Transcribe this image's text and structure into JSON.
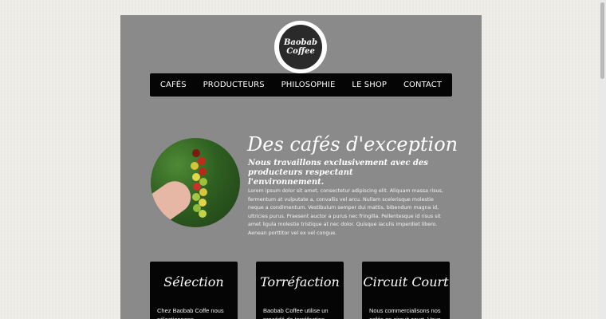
{
  "logo": {
    "text_line1": "Baobab",
    "text_line2": "Coffee"
  },
  "nav": {
    "items": [
      "CAFÉS",
      "PRODUCTEURS",
      "PHILOSOPHIE",
      "LE SHOP",
      "CONTACT"
    ]
  },
  "hero": {
    "title": "Des cafés d'exception",
    "subtitle": "Nous travaillons exclusivement avec des producteurs respectant l'environnement.",
    "body": "Lorem ipsum dolor sit amet, consectetur adipiscing elit. Aliquam massa risus, fermentum at vulputate a, convallis vel arcu. Nullam scelerisque molestie neque a condimentum. Vestibulum semper dui mattis, bibendum magna id, ultricies purus. Praesent auctor a purus nec fringilla. Pellentesque id risus sit amet ligula molestie tristique at nec dolor. Quisque iaculis imperdiet libero. Aenean porttitor vel ex vel congue."
  },
  "cards": [
    {
      "title": "Sélection",
      "text": "Chez Baobab Coffe nous sélectionnons rigoureusement"
    },
    {
      "title": "Torréfaction",
      "text": "Baobab Coffee utilise un procédé de torréfaction lente à"
    },
    {
      "title": "Circuit Court",
      "text": "Nous commercialisons nos cafés en circuit court. Vous"
    }
  ],
  "colors": {
    "page_bg": "#efede8",
    "content_bg": "#8a8a8a",
    "nav_bg": "#050505",
    "text": "#ffffff"
  }
}
